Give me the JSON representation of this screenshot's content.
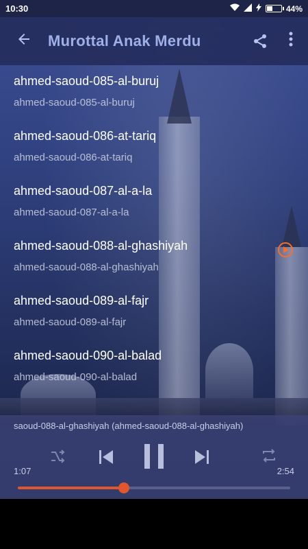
{
  "statusbar": {
    "time": "10:30",
    "battery_text": "44%",
    "battery_level": 0.44
  },
  "appbar": {
    "title": "Murottal Anak Merdu",
    "icons": [
      "back-arrow-icon",
      "share-icon",
      "more-vert-icon"
    ]
  },
  "tracks": [
    {
      "title": "ahmed-saoud-085-al-buruj",
      "subtitle": "ahmed-saoud-085-al-buruj"
    },
    {
      "title": "ahmed-saoud-086-at-tariq",
      "subtitle": "ahmed-saoud-086-at-tariq"
    },
    {
      "title": "ahmed-saoud-087-al-a-la",
      "subtitle": "ahmed-saoud-087-al-a-la"
    },
    {
      "title": "ahmed-saoud-088-al-ghashiyah",
      "subtitle": "ahmed-saoud-088-al-ghashiyah"
    },
    {
      "title": "ahmed-saoud-089-al-fajr",
      "subtitle": "ahmed-saoud-089-al-fajr"
    },
    {
      "title": "ahmed-saoud-090-al-balad",
      "subtitle": "ahmed-saoud-090-al-balad"
    }
  ],
  "playing_index": 3,
  "player": {
    "now_playing": "saoud-088-al-ghashiyah (ahmed-saoud-088-al-ghashiyah)",
    "elapsed": "1:07",
    "duration": "2:54",
    "progress_fraction": 0.39
  },
  "colors": {
    "accent": "#e2562c",
    "appbar": "#242c5c"
  }
}
